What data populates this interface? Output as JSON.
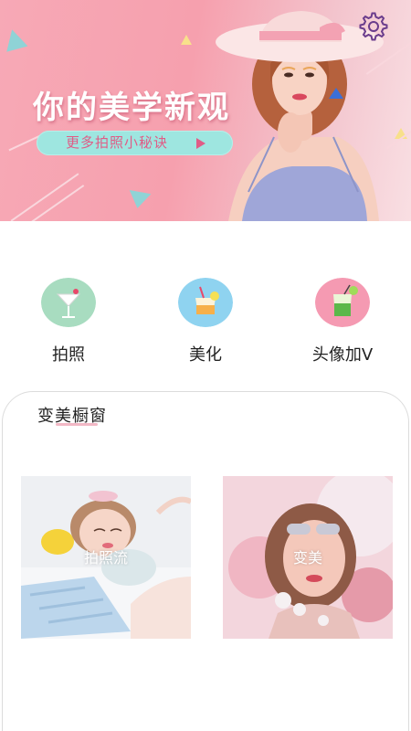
{
  "banner": {
    "title": "你的美学新观",
    "cta_label": "更多拍照小秘诀",
    "settings_icon": "gear-icon",
    "colors": {
      "background": "#f7a9b6",
      "cta_bg": "#9ee6e0",
      "cta_text": "#e05c86"
    }
  },
  "menu": {
    "items": [
      {
        "label": "拍照",
        "icon": "cocktail-icon",
        "color": "#a8dcc0"
      },
      {
        "label": "美化",
        "icon": "drink-icon",
        "color": "#8fd3f0"
      },
      {
        "label": "头像加V",
        "icon": "mojito-icon",
        "color": "#f59ab2"
      }
    ]
  },
  "showcase": {
    "title": "变美橱窗",
    "photos": [
      {
        "label": "拍照流"
      },
      {
        "label": "变美"
      }
    ]
  }
}
